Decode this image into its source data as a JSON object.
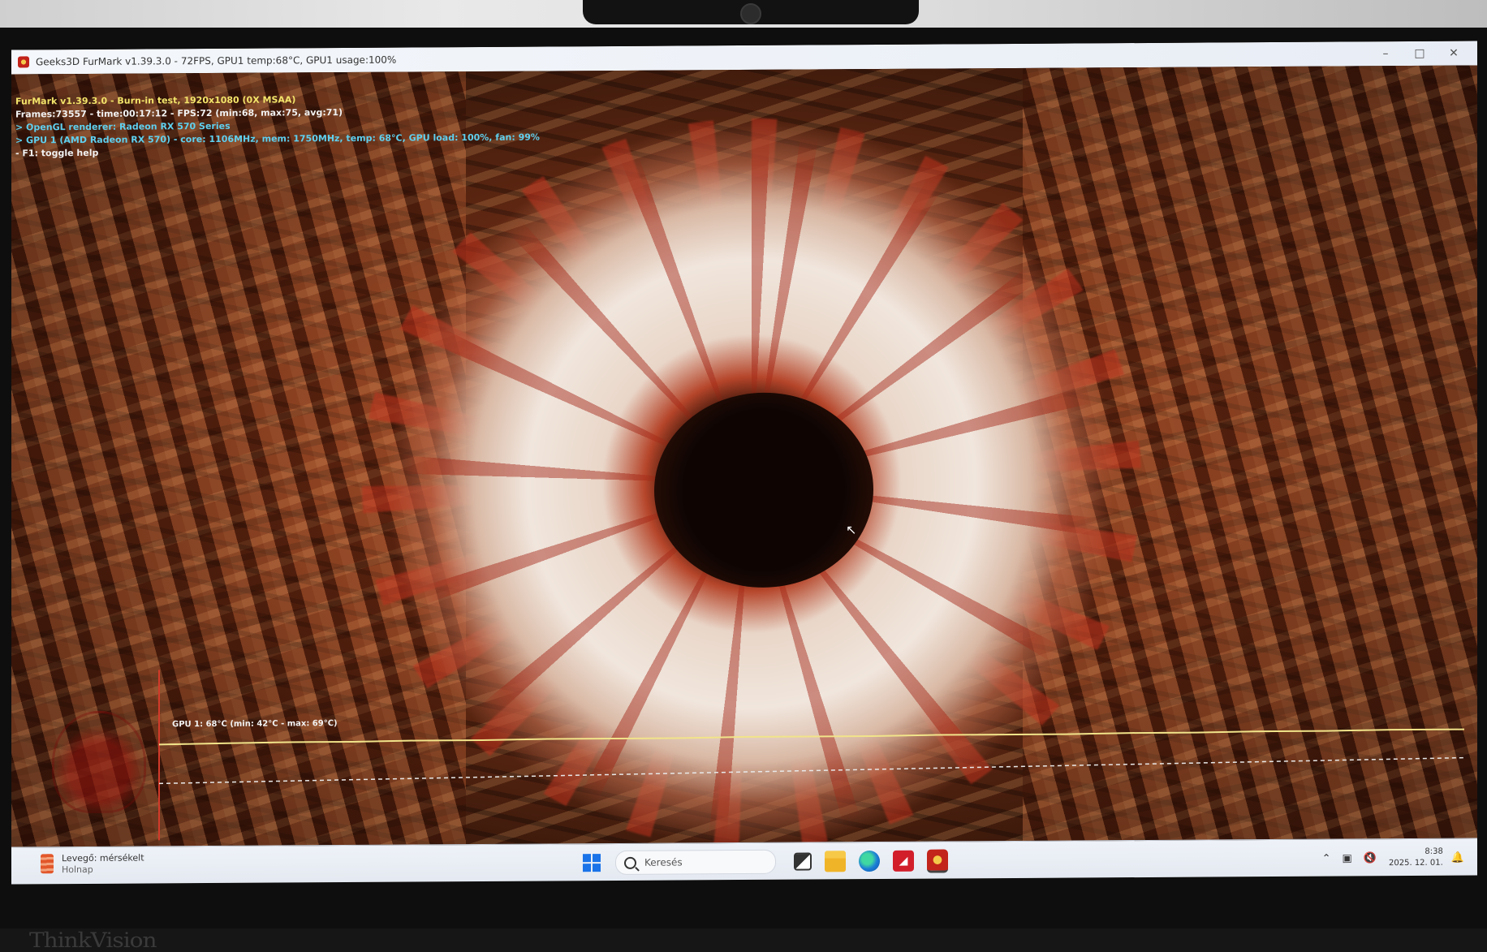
{
  "window": {
    "title": "Geeks3D FurMark v1.39.3.0 - 72FPS, GPU1 temp:68°C, GPU1 usage:100%",
    "minimize_icon": "minimize-icon",
    "maximize_icon": "maximize-icon",
    "close_icon": "close-icon"
  },
  "osd": {
    "line1": "FurMark v1.39.3.0 - Burn-in test, 1920x1080 (0X MSAA)",
    "line2": "Frames:73557 - time:00:17:12 - FPS:72 (min:68, max:75, avg:71)",
    "line3": "> OpenGL renderer: Radeon RX 570 Series",
    "line4": "> GPU 1 (AMD Radeon RX 570) - core: 1106MHz, mem: 1750MHz, temp: 68°C, GPU load: 100%, fan: 99%",
    "line5": "- F1: toggle help"
  },
  "graph": {
    "label": "GPU 1: 68°C (min: 42°C - max: 69°C)"
  },
  "taskbar": {
    "weather_label": "Levegő: mérsékelt",
    "weather_sub": "Holnap",
    "search_placeholder": "Keresés",
    "time": "8:38",
    "date": "2025. 12. 01."
  },
  "bezel": {
    "brand": "ThinkVision"
  },
  "colors": {
    "osd_yellow": "#f3e46a",
    "osd_cyan": "#5fd0ef",
    "graph_line": "#f1e48a"
  }
}
